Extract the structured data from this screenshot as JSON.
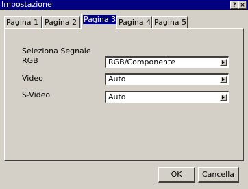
{
  "window": {
    "title": "Impostazione",
    "help_label": "?",
    "close_label": "×"
  },
  "tabs": [
    {
      "label": "Pagina 1",
      "active": false
    },
    {
      "label": "Pagina 2",
      "active": false
    },
    {
      "label": "Pagina 3",
      "active": true
    },
    {
      "label": "Pagina 4",
      "active": false
    },
    {
      "label": "Pagina 5",
      "active": false
    }
  ],
  "section": {
    "title": "Seleziona Segnale",
    "rows": [
      {
        "label": "RGB",
        "value": "RGB/Componente"
      },
      {
        "label": "Video",
        "value": "Auto"
      },
      {
        "label": "S-Video",
        "value": "Auto"
      }
    ]
  },
  "buttons": {
    "ok": "OK",
    "cancel": "Cancella"
  }
}
